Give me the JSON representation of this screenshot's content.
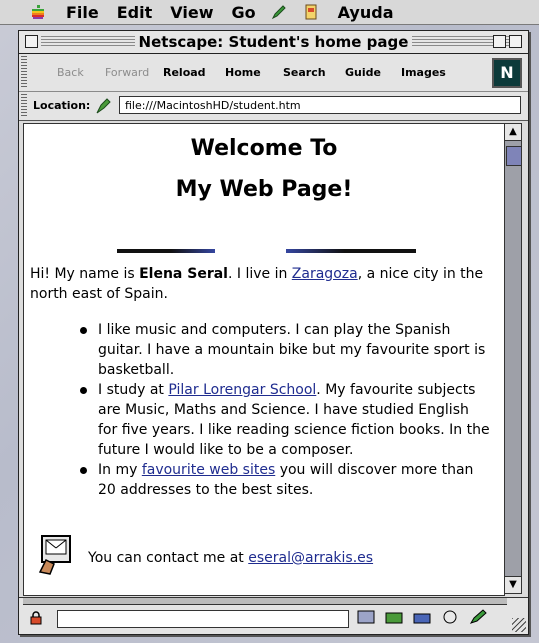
{
  "menubar": {
    "items": [
      "File",
      "Edit",
      "View",
      "Go",
      "Ayuda"
    ],
    "icons": [
      "apple-icon",
      "pencil-icon",
      "app-icon"
    ]
  },
  "window": {
    "title": "Netscape: Student's home page"
  },
  "toolbar": {
    "back": "Back",
    "forward": "Forward",
    "reload": "Reload",
    "home": "Home",
    "search": "Search",
    "guide": "Guide",
    "images": "Images",
    "logo": "N"
  },
  "location": {
    "label": "Location:",
    "url": "file:///MacintoshHD/student.htm"
  },
  "page": {
    "heading_line1": "Welcome To",
    "heading_line2": "My Web Page!",
    "intro_prefix": "Hi! My name is ",
    "name": "Elena Seral",
    "intro_middle": ". I live in ",
    "city_link": "Zaragoza",
    "intro_suffix": ", a nice city in the north east of Spain.",
    "bullet1": "I like music and computers. I can play the Spanish guitar. I have a mountain bike but my favourite sport is basketball.",
    "bullet2_prefix": "I study at ",
    "school_link": "Pilar Lorengar School",
    "bullet2_suffix": ". My favourite subjects are Music, Maths and Science. I have studied English for five years. I like reading science fiction books. In the future I would like to be a composer.",
    "bullet3_prefix": "In my ",
    "sites_link": "favourite web sites",
    "bullet3_suffix": " you will discover more than 20 addresses to the best sites.",
    "contact_prefix": "You can contact me at ",
    "email_link": "eseral@arrakis.es"
  }
}
